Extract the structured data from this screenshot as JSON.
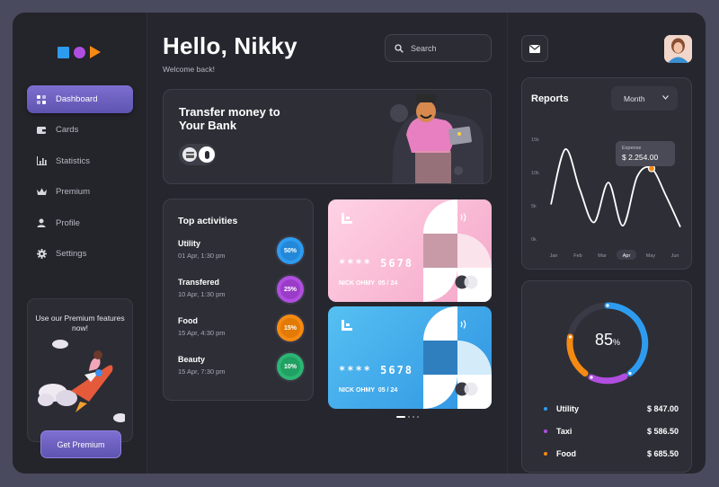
{
  "header": {
    "greeting": "Hello, Nikky",
    "subtitle": "Welcome back!"
  },
  "search": {
    "placeholder": "Search"
  },
  "sidebar": {
    "items": [
      {
        "label": "Dashboard",
        "icon": "grid-icon",
        "active": true
      },
      {
        "label": "Cards",
        "icon": "wallet-icon"
      },
      {
        "label": "Statistics",
        "icon": "bar-chart-icon"
      },
      {
        "label": "Premium",
        "icon": "crown-icon"
      },
      {
        "label": "Profile",
        "icon": "user-icon"
      },
      {
        "label": "Settings",
        "icon": "gear-icon"
      }
    ],
    "promo": {
      "text": "Use our Premium features now!",
      "button": "Get Premium"
    }
  },
  "transfer": {
    "title": "Transfer money to Your Bank"
  },
  "activities": {
    "title": "Top activities",
    "items": [
      {
        "name": "Utility",
        "date": "01 Apr, 1:30 pm",
        "percent": "50%",
        "color": "#2d9cf0"
      },
      {
        "name": "Transfered",
        "date": "10 Apr, 1:30 pm",
        "percent": "25%",
        "color": "#b04ee0"
      },
      {
        "name": "Food",
        "date": "15 Apr, 4:30 pm",
        "percent": "15%",
        "color": "#f58a12"
      },
      {
        "name": "Beauty",
        "date": "15 Apr, 7:30 pm",
        "percent": "10%",
        "color": "#2bb673"
      }
    ]
  },
  "cards": [
    {
      "number": "**** 5678",
      "holder": "NICK OHMY",
      "expiry": "05 / 24",
      "style": "pink"
    },
    {
      "number": "**** 5678",
      "holder": "NICK OHMY",
      "expiry": "05 / 24",
      "style": "blue"
    }
  ],
  "reports": {
    "title": "Reports",
    "period": "Month",
    "tooltip": {
      "label": "Expense",
      "value": "$ 2.254.00"
    }
  },
  "chart_data": {
    "type": "line",
    "categories": [
      "Jan",
      "Feb",
      "Mar",
      "Apr",
      "May",
      "Jun"
    ],
    "y_ticks": [
      "15k",
      "10k",
      "5k",
      "0k"
    ],
    "ylim": [
      0,
      15000
    ],
    "selected_category": "Apr",
    "series": [
      {
        "values": [
          5200,
          13500,
          7500,
          2500,
          8500,
          2000,
          9400,
          10600,
          6500,
          1800
        ]
      }
    ]
  },
  "summary": {
    "percent": "85",
    "percent_unit": "%",
    "items": [
      {
        "name": "Utility",
        "amount": "$ 847.00",
        "color": "#2d9cf0"
      },
      {
        "name": "Taxi",
        "amount": "$ 586.50",
        "color": "#b04ee0"
      },
      {
        "name": "Food",
        "amount": "$ 685.50",
        "color": "#f58a12"
      }
    ]
  }
}
